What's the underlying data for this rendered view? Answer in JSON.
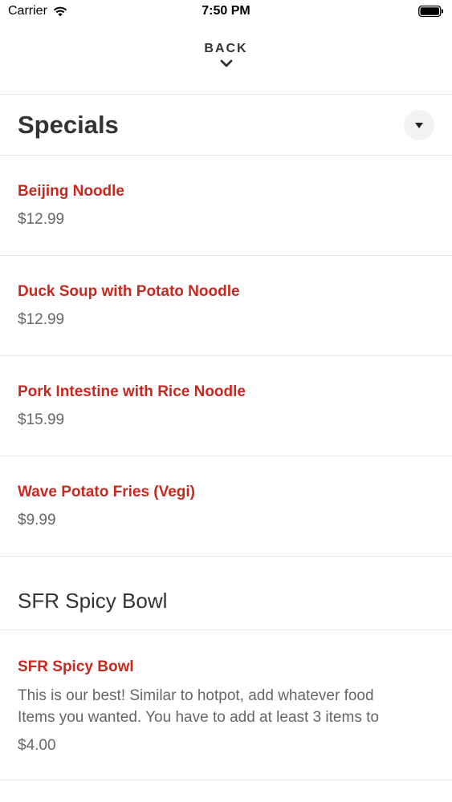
{
  "status_bar": {
    "carrier": "Carrier",
    "time": "7:50 PM"
  },
  "header": {
    "back_label": "BACK"
  },
  "sections": [
    {
      "title": "Specials",
      "items": [
        {
          "name": "Beijing Noodle",
          "price": "$12.99"
        },
        {
          "name": "Duck Soup with Potato Noodle",
          "price": "$12.99"
        },
        {
          "name": "Pork Intestine with Rice Noodle",
          "price": "$15.99"
        },
        {
          "name": "Wave Potato Fries (Vegi)",
          "price": "$9.99"
        }
      ]
    },
    {
      "title": "SFR Spicy Bowl",
      "items": [
        {
          "name": "SFR Spicy Bowl",
          "description_line1": "This is our best! Similar to hotpot, add whatever food",
          "description_line2": "Items you wanted. You have to add at least 3 items to",
          "price": "$4.00"
        }
      ]
    }
  ],
  "colors": {
    "accent": "#c8281e",
    "text": "#333333",
    "muted": "#666666",
    "divider": "#e6e6e6"
  },
  "icons": {
    "wifi": "wifi-icon",
    "battery": "battery-icon",
    "back": "chevron-down-icon",
    "dropdown": "caret-down-icon"
  }
}
